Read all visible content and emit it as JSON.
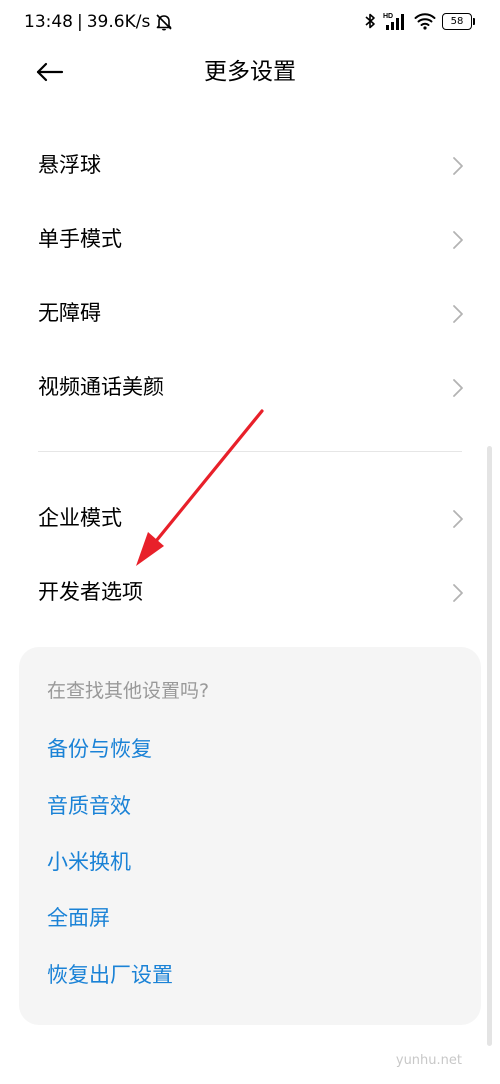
{
  "status_bar": {
    "time": "13:48",
    "separator": "|",
    "network_speed": "39.6K/s",
    "battery": "58",
    "icons": [
      "mute-bell-icon",
      "bluetooth-icon",
      "hd-signal-icon",
      "wifi-icon",
      "battery-icon"
    ]
  },
  "header": {
    "title": "更多设置",
    "back_icon": "back-arrow-icon"
  },
  "settings": {
    "items": [
      {
        "label": "悬浮球"
      },
      {
        "label": "单手模式"
      },
      {
        "label": "无障碍"
      },
      {
        "label": "视频通话美颜"
      },
      {
        "label": "企业模式"
      },
      {
        "label": "开发者选项"
      }
    ]
  },
  "suggestions": {
    "title": "在查找其他设置吗?",
    "links": [
      {
        "label": "备份与恢复"
      },
      {
        "label": "音质音效"
      },
      {
        "label": "小米换机"
      },
      {
        "label": "全面屏"
      },
      {
        "label": "恢复出厂设置"
      }
    ]
  },
  "watermark": "yunhu.net",
  "colors": {
    "link": "#1a82d6",
    "muted_text": "#999999",
    "card_bg": "#f5f5f5",
    "annotation_arrow": "#e8202a"
  }
}
